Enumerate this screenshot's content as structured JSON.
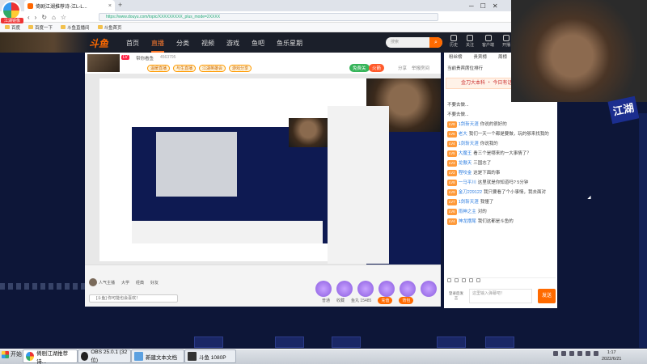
{
  "browser": {
    "logo_label": "江湖镜像",
    "tab_title": "倚剧江湖推荐诗-江L-L...",
    "tab_close": "×",
    "newtab": "+",
    "nav": [
      "‹",
      "›",
      "↻",
      "⌂",
      "☆"
    ],
    "address": "https://www.douyu.com/topic/XXXXXXXXX_plus_mode=2XXXX",
    "bookmarks": [
      "百度",
      "百度一下",
      "斗鱼直播间",
      "斗鱼首页"
    ],
    "winctl": [
      "─",
      "☐",
      "✕"
    ]
  },
  "header": {
    "brand": "斗鱼",
    "menu": [
      "首页",
      "直播",
      "分类",
      "视频",
      "游戏",
      "鱼吧",
      "鱼乐星期"
    ],
    "active_menu": "直播",
    "search_placeholder": "搜索",
    "icons": [
      "历史",
      "关注",
      "客户端",
      "开播",
      "创作"
    ]
  },
  "stream": {
    "level": "LV",
    "room_name": "带你看鱼",
    "room_id": "4563795",
    "tags": [
      "温暖直播",
      "与生直播",
      "江湖英雄会",
      "游戏分享"
    ],
    "follow_label": "免费关",
    "fire_label": "火箭",
    "share_label": "分享",
    "report_label": "举报房间"
  },
  "controls": {
    "names": [
      "人气主播",
      "大学",
      "经典",
      "好友"
    ],
    "chat_placeholder": "[斗鱼] 你可能也会喜欢！",
    "stats": [
      "普通",
      "收藏",
      "鱼丸 15485"
    ],
    "btn1": "充值",
    "btn2": "背包"
  },
  "chat": {
    "tabs": [
      "粉丝榜",
      "贵宾榜",
      "周榜",
      "荣誉"
    ],
    "rank": "当前贵宾席位排行",
    "anchor": "金刀大本科 ・ 今日有话来",
    "messages": [
      {
        "badge": "",
        "user": "",
        "text": "不要去做..."
      },
      {
        "badge": "",
        "user": "",
        "text": "不要去做..."
      },
      {
        "badge": "LV8",
        "user": "1剑斩天涯",
        "text": "你说的很好的"
      },
      {
        "badge": "LV6",
        "user": "老大",
        "text": "我们一天一个都是要做，玩的够来找我的"
      },
      {
        "badge": "LV4",
        "user": "1剑斩天涯",
        "text": "你说我的"
      },
      {
        "badge": "LV5",
        "user": "大魔王",
        "text": "看三个是哪来的一大事情了？"
      },
      {
        "badge": "LV3",
        "user": "龙傲天",
        "text": "三国志了"
      },
      {
        "badge": "LV2",
        "user": "程咬金",
        "text": "这是下面的事"
      },
      {
        "badge": "LV8",
        "user": "一马平川",
        "text": "这里就是你知道吗? 5分钟"
      },
      {
        "badge": "LV9",
        "user": "金刀229122",
        "text": "我只要看了个小事情，我去面对"
      },
      {
        "badge": "LV7",
        "user": "1剑斩天涯",
        "text": "我懂了"
      },
      {
        "badge": "LV6",
        "user": "雨神之主",
        "text": "对的"
      },
      {
        "badge": "LV4",
        "user": "神龙摆尾",
        "text": "我们这都是斗鱼的"
      }
    ],
    "login_hint": "登录后发言",
    "input_placeholder": "这里输入弹幕吧！",
    "send_label": "发送"
  },
  "cam": {
    "neon": "江湖",
    "sky": "江湖"
  },
  "taskbar": {
    "start": "开始",
    "items": [
      {
        "label": "倚剧江湖推荐诗..."
      },
      {
        "label": "OBS 25.0.1 (32位)"
      },
      {
        "label": "新建文本文档"
      },
      {
        "label": "斗鱼 1080P"
      }
    ],
    "clock_time": "1:17",
    "clock_date": "2022/6/21"
  }
}
